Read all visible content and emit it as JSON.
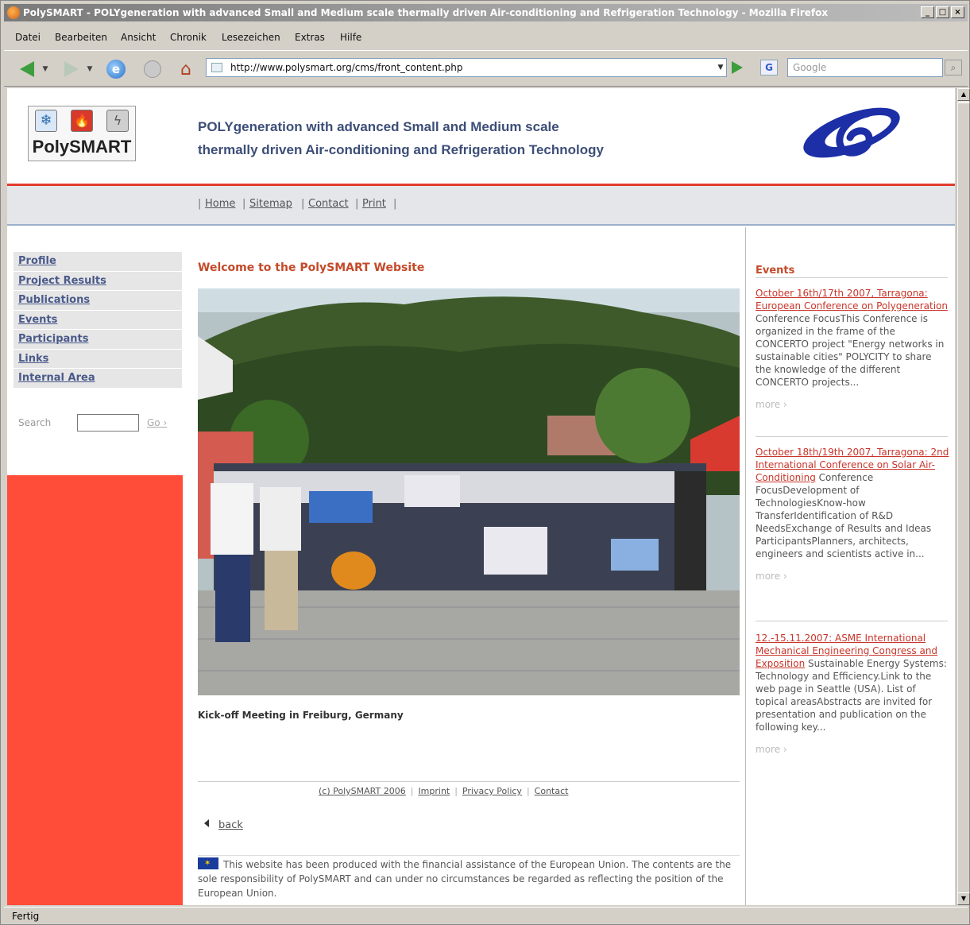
{
  "window": {
    "title": "PolySMART - POLYgeneration with advanced Small and Medium scale thermally driven Air-conditioning and Refrigeration Technology - Mozilla Firefox"
  },
  "menu": [
    "Datei",
    "Bearbeiten",
    "Ansicht",
    "Chronik",
    "Lesezeichen",
    "Extras",
    "Hilfe"
  ],
  "address": {
    "url": "http://www.polysmart.org/cms/front_content.php",
    "search_placeholder": "Google"
  },
  "status": "Fertig",
  "site": {
    "logo_text": "PolySMART",
    "tagline_line1": "POLYgeneration with advanced Small and Medium scale",
    "tagline_line2": "thermally driven Air-conditioning and Refrigeration Technology",
    "topnav": [
      "Home",
      "Sitemap",
      "Contact",
      "Print"
    ],
    "leftnav": [
      "Profile",
      "Project Results",
      "Publications",
      "Events",
      "Participants",
      "Links",
      "Internal Area"
    ],
    "search_label": "Search",
    "go_label": "Go"
  },
  "main": {
    "welcome": "Welcome to the PolySMART Website",
    "caption": "Kick-off Meeting in Freiburg, Germany",
    "footer_links": [
      "(c) PolySMART 2006",
      "Imprint",
      "Privacy Policy",
      "Contact"
    ],
    "back": "back",
    "eu_note": "This website has been produced with the financial assistance of the European Union. The contents are the sole responsibility of PolySMART and can under no circumstances be regarded as reflecting the position of the European Union."
  },
  "events": {
    "heading": "Events",
    "more": "more",
    "items": [
      {
        "title": "October 16th/17th 2007, Tarragona: European Conference on Polygeneration",
        "body": " Conference FocusThis Conference is organized in the frame of the CONCERTO project \"Energy networks in sustainable cities\" POLYCITY to share the knowledge of the different CONCERTO projects..."
      },
      {
        "title": "October 18th/19th 2007, Tarragona: 2nd International Conference on Solar Air-Conditioning",
        "body": " Conference FocusDevelopment of TechnologiesKnow-how TransferIdentification of R&D NeedsExchange of Results and Ideas ParticipantsPlanners, architects, engineers and scientists active in..."
      },
      {
        "title": "12.-15.11.2007: ASME International Mechanical Engineering Congress and Exposition",
        "body": " Sustainable Energy Systems: Technology and Efficiency.Link to the web page in Seattle (USA). List of topical areasAbstracts are invited for presentation and publication on the following key..."
      }
    ]
  },
  "colors": {
    "accent_red": "#e23a2e",
    "heading": "#c44a2a",
    "tagline": "#3c4e78",
    "side_panel": "#ff4d3a"
  }
}
